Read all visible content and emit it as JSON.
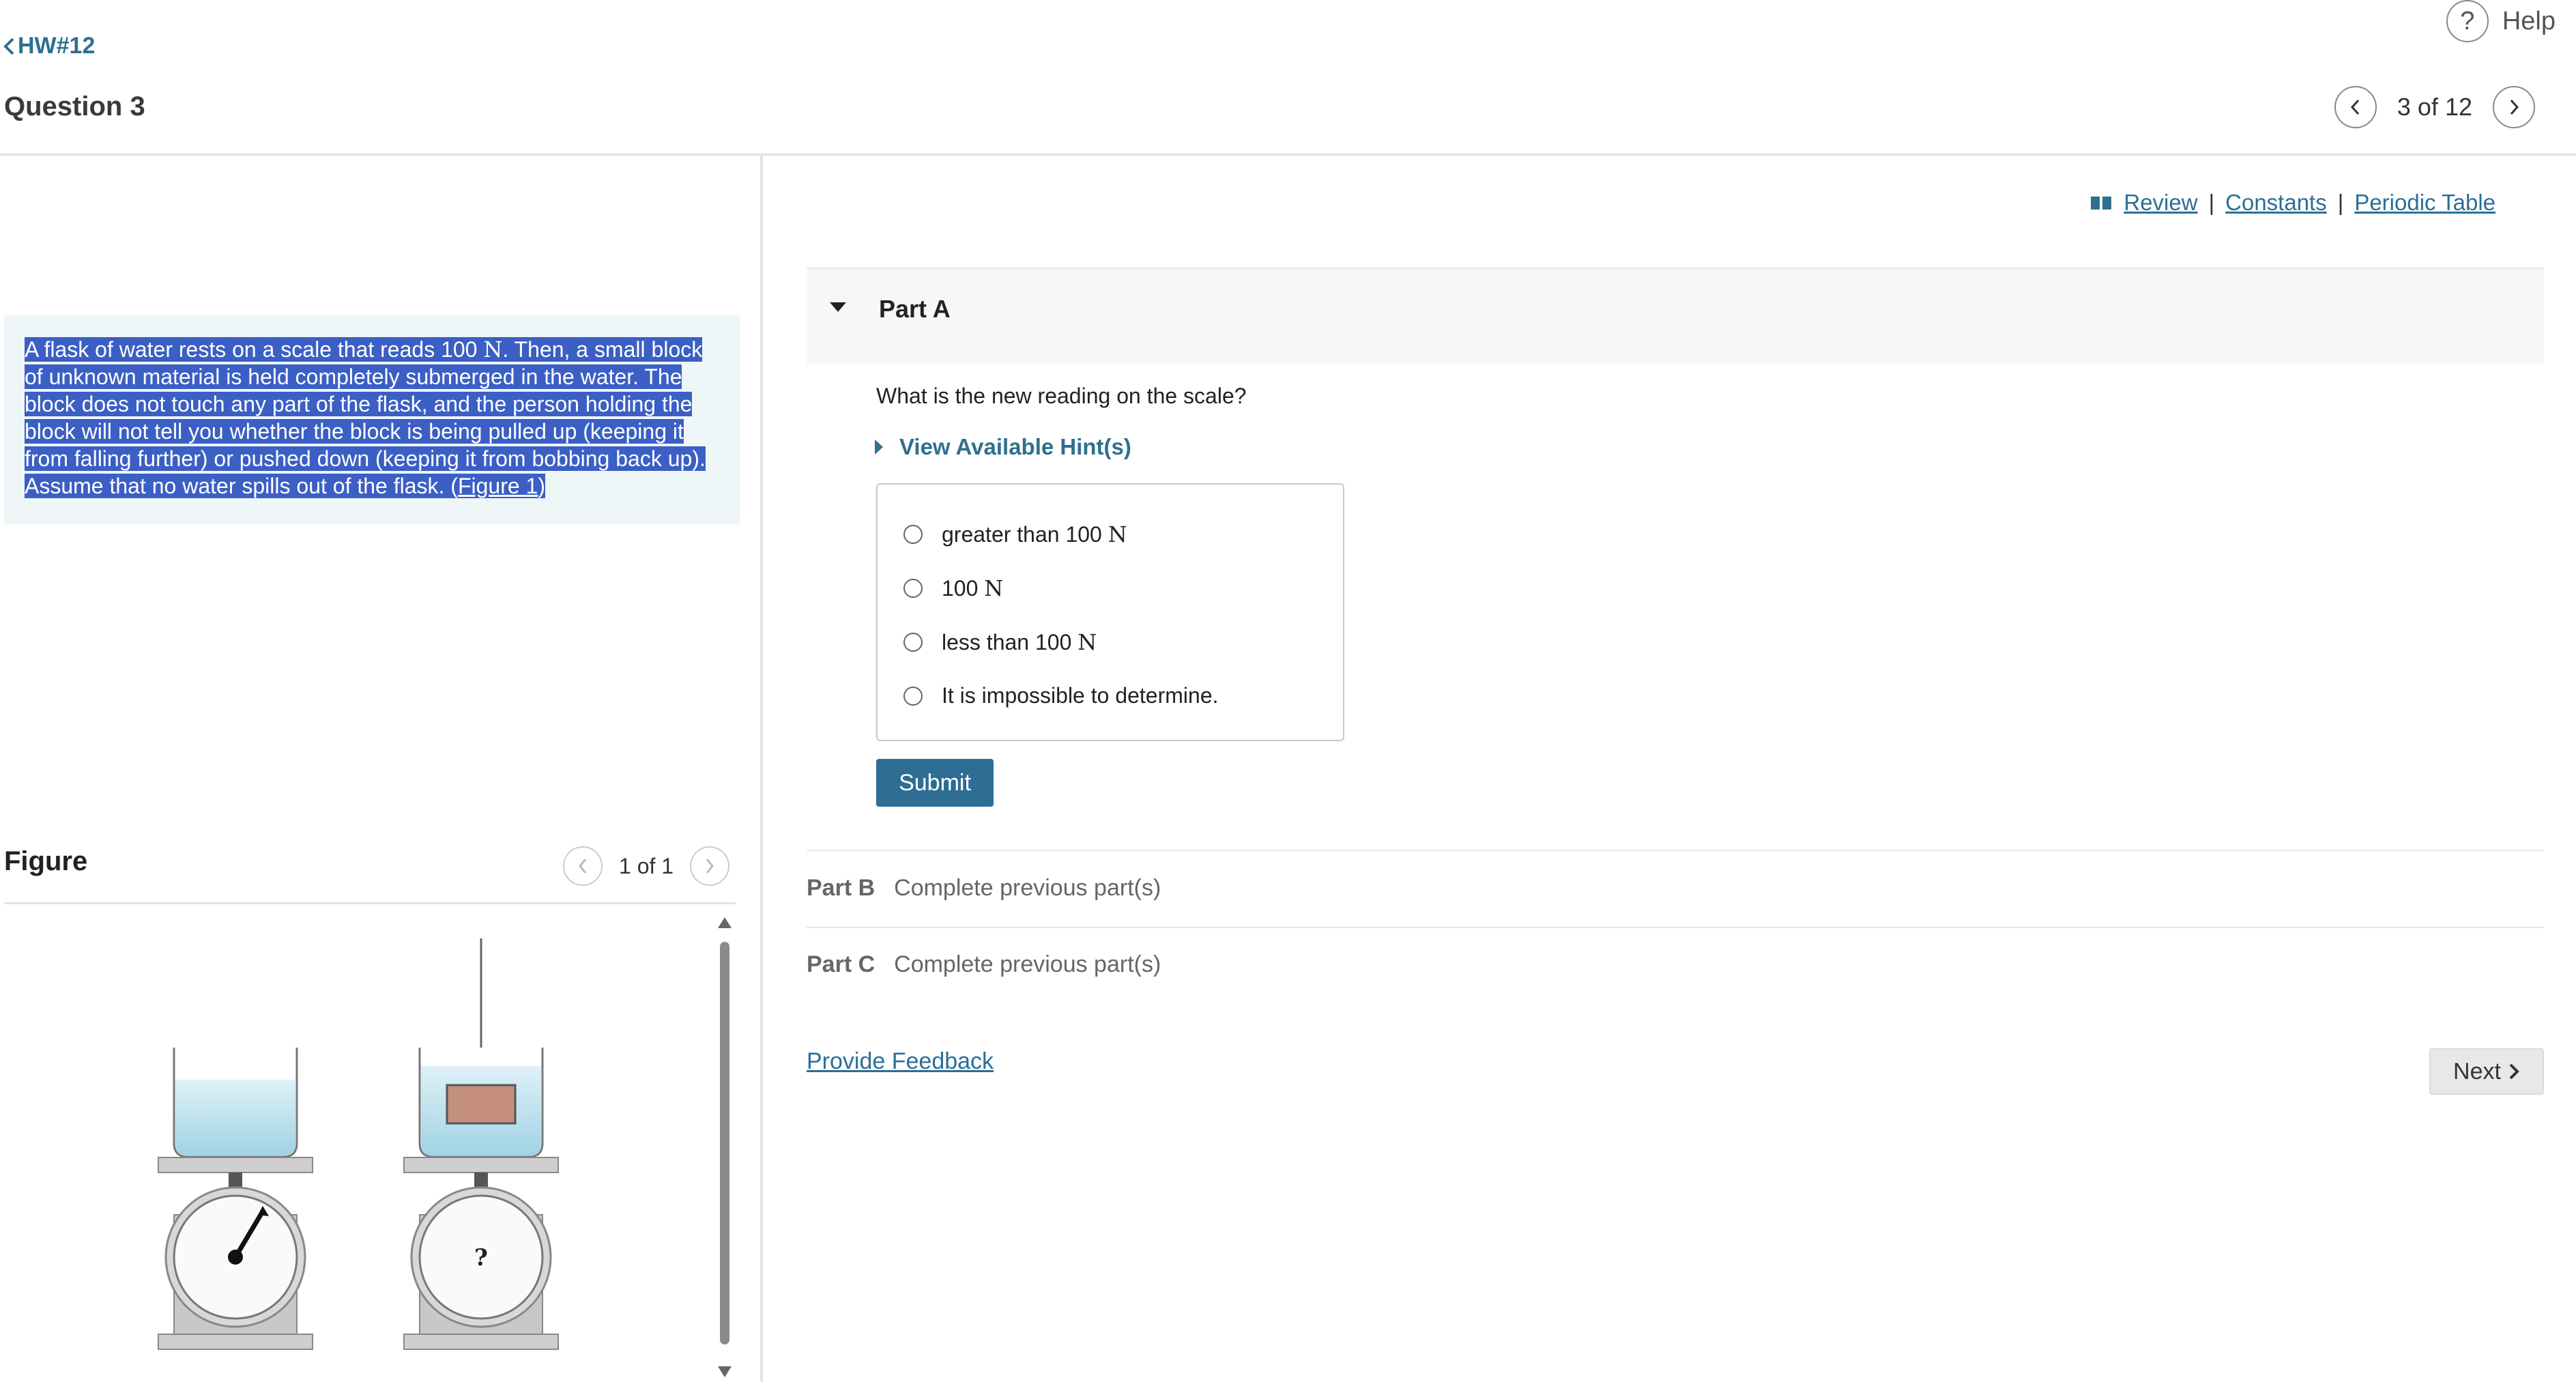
{
  "header": {
    "back_label": "HW#12",
    "question_title": "Question 3",
    "help_label": "Help",
    "help_icon_glyph": "?",
    "pager_text": "3 of 12"
  },
  "problem": {
    "part1": "A flask of water rests on a scale that reads 100 ",
    "unit": "N",
    "part2": ". Then, a small block of unknown material is held completely submerged in the water. The block does not touch any part of the flask, and the person holding the block will not tell you whether the block is being pulled up (keeping it from falling further) or pushed down (keeping it from bobbing back up). Assume that no water spills out of the flask. (",
    "figure_link": "Figure 1",
    "part3": ")"
  },
  "figure": {
    "title": "Figure",
    "pager_text": "1 of 1",
    "scale2_dial_label": "?"
  },
  "resources": {
    "review": "Review",
    "separator": "|",
    "constants": "Constants",
    "periodic_table": "Periodic Table"
  },
  "part_a": {
    "label": "Part A",
    "question": "What is the new reading on the scale?",
    "hint_label": "View Available Hint(s)",
    "options": [
      {
        "text": "greater than 100 ",
        "unit": "N"
      },
      {
        "text": "100 ",
        "unit": "N"
      },
      {
        "text": "less than 100 ",
        "unit": "N"
      },
      {
        "text": "It is impossible to determine.",
        "unit": ""
      }
    ],
    "submit_label": "Submit"
  },
  "part_b": {
    "label": "Part B",
    "status": "Complete previous part(s)"
  },
  "part_c": {
    "label": "Part C",
    "status": "Complete previous part(s)"
  },
  "footer": {
    "feedback_label": "Provide Feedback",
    "next_label": "Next"
  },
  "colors": {
    "accent": "#2f6f8f",
    "selection": "#3b5fc4",
    "problem_bg": "#eef6f8",
    "water": "#a9d8e6",
    "block": "#c4907c"
  }
}
